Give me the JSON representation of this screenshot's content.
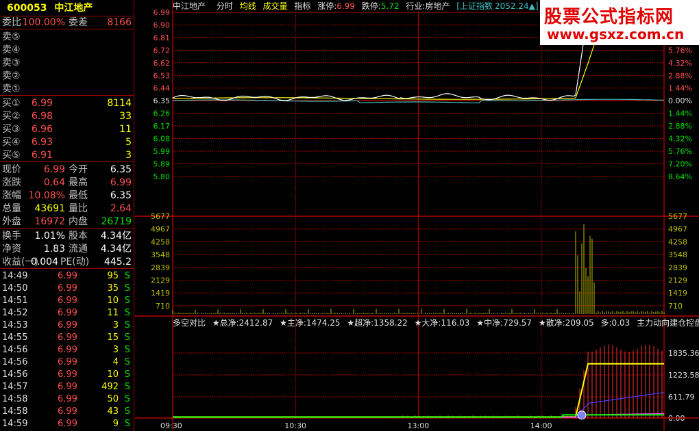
{
  "header": {
    "code": "600053",
    "name": "中江地产"
  },
  "ratio": {
    "label": "委比",
    "value": "100.00%",
    "diff_label": "委差",
    "diff_value": "8166"
  },
  "sell": [
    {
      "label": "卖⑤",
      "price": "",
      "volume": ""
    },
    {
      "label": "卖④",
      "price": "",
      "volume": ""
    },
    {
      "label": "卖③",
      "price": "",
      "volume": ""
    },
    {
      "label": "卖②",
      "price": "",
      "volume": ""
    },
    {
      "label": "卖①",
      "price": "",
      "volume": ""
    }
  ],
  "buy": [
    {
      "label": "买①",
      "price": "6.99",
      "volume": "8114"
    },
    {
      "label": "买②",
      "price": "6.98",
      "volume": "33"
    },
    {
      "label": "买③",
      "price": "6.96",
      "volume": "11"
    },
    {
      "label": "买④",
      "price": "6.93",
      "volume": "5"
    },
    {
      "label": "买⑤",
      "price": "6.91",
      "volume": "3"
    }
  ],
  "quote": {
    "price_label": "现价",
    "price": "6.99",
    "open_label": "今开",
    "open": "6.35",
    "change_label": "涨跌",
    "change": "0.64",
    "high_label": "最高",
    "high": "6.99",
    "pct_label": "涨幅",
    "pct": "10.08%",
    "low_label": "最低",
    "low": "6.35",
    "vol_label": "总量",
    "vol": "43691",
    "vr_label": "量比",
    "vr": "2.64",
    "out_label": "外盘",
    "out": "16972",
    "in_label": "内盘",
    "in": "26719"
  },
  "stats": {
    "turnover_label": "换手",
    "turnover": "1.01%",
    "shares_label": "股本",
    "shares": "4.34亿",
    "nav_label": "净资",
    "nav": "1.83",
    "float_label": "流通",
    "float": "4.34亿",
    "eps_label": "收益(一)",
    "eps": "0.004",
    "pe_label": "PE(动)",
    "pe": "445.2"
  },
  "trades": [
    {
      "time": "14:49",
      "price": "6.99",
      "vol": "95",
      "flag": "S"
    },
    {
      "time": "14:50",
      "price": "6.99",
      "vol": "35",
      "flag": "S"
    },
    {
      "time": "14:51",
      "price": "6.99",
      "vol": "10",
      "flag": "S"
    },
    {
      "time": "14:52",
      "price": "6.99",
      "vol": "11",
      "flag": "S"
    },
    {
      "time": "14:53",
      "price": "6.99",
      "vol": "3",
      "flag": "S"
    },
    {
      "time": "14:55",
      "price": "6.99",
      "vol": "15",
      "flag": "S"
    },
    {
      "time": "14:56",
      "price": "6.99",
      "vol": "3",
      "flag": "S"
    },
    {
      "time": "14:56",
      "price": "6.99",
      "vol": "4",
      "flag": "S"
    },
    {
      "time": "14:56",
      "price": "6.99",
      "vol": "10",
      "flag": "S"
    },
    {
      "time": "14:57",
      "price": "6.99",
      "vol": "492",
      "flag": "S"
    },
    {
      "time": "14:58",
      "price": "6.99",
      "vol": "50",
      "flag": "S"
    },
    {
      "time": "14:58",
      "price": "6.99",
      "vol": "43",
      "flag": "S"
    },
    {
      "time": "14:59",
      "price": "6.99",
      "vol": "9",
      "flag": "S"
    }
  ],
  "titlebar": {
    "name": "中江地产",
    "tab1": "分时",
    "tab2": "均线",
    "tab3": "成交量",
    "tab4": "指标",
    "up_label": "涨停:",
    "up_value": "6.99",
    "down_label": "跌停:",
    "down_value": "5.72",
    "industry_label": "行业:",
    "industry": "房地产",
    "index_name": "[上证指数",
    "index_value": "2052.24▲]"
  },
  "indicator": {
    "name": "多空对比",
    "items": [
      "★总净:2412.87",
      "★主净:1474.25",
      "★超净:1358.22",
      "★大净:116.03",
      "★中净:729.57",
      "★散净:209.05",
      "多:0.03"
    ],
    "tail": "主力动向建仓控盘拉升"
  },
  "watermark": {
    "line1": "股票公式指标网",
    "line2": "www.gsxz.com.cn"
  },
  "chart_data": {
    "type": "line",
    "price_ticks_left": [
      "6.99",
      "6.90",
      "6.81",
      "6.72",
      "6.62",
      "6.53",
      "6.44",
      "6.35",
      "6.26",
      "6.17",
      "6.08",
      "5.99",
      "5.89",
      "5.80"
    ],
    "pct_ticks_right": [
      "",
      "",
      "7.20%",
      "5.76%",
      "4.32%",
      "2.88%",
      "1.44%",
      "0.00%",
      "1.44%",
      "2.88%",
      "4.32%",
      "5.76%",
      "7.20%",
      "8.64%"
    ],
    "volume_ticks": [
      "5677",
      "4967",
      "4258",
      "3548",
      "2839",
      "2129",
      "1419",
      "710"
    ],
    "indicator_ticks": [
      "1835.36",
      "1223.58",
      "611.79",
      "0.00"
    ],
    "time_labels": [
      "09:30",
      "10:30",
      "13:00",
      "14:00"
    ],
    "prev_close": 6.35,
    "limit_up": 6.99,
    "ylim": [
      5.8,
      6.99
    ],
    "volume_ylim": [
      0,
      5677
    ],
    "indicator_ylim": [
      0,
      2400
    ],
    "colors": {
      "price": "#ffffff",
      "avg": "#ffff00",
      "index": "#40c0c0",
      "grid": "#a00000",
      "volume": "#c0c000",
      "up": "#ff4040",
      "down": "#00e000"
    }
  }
}
